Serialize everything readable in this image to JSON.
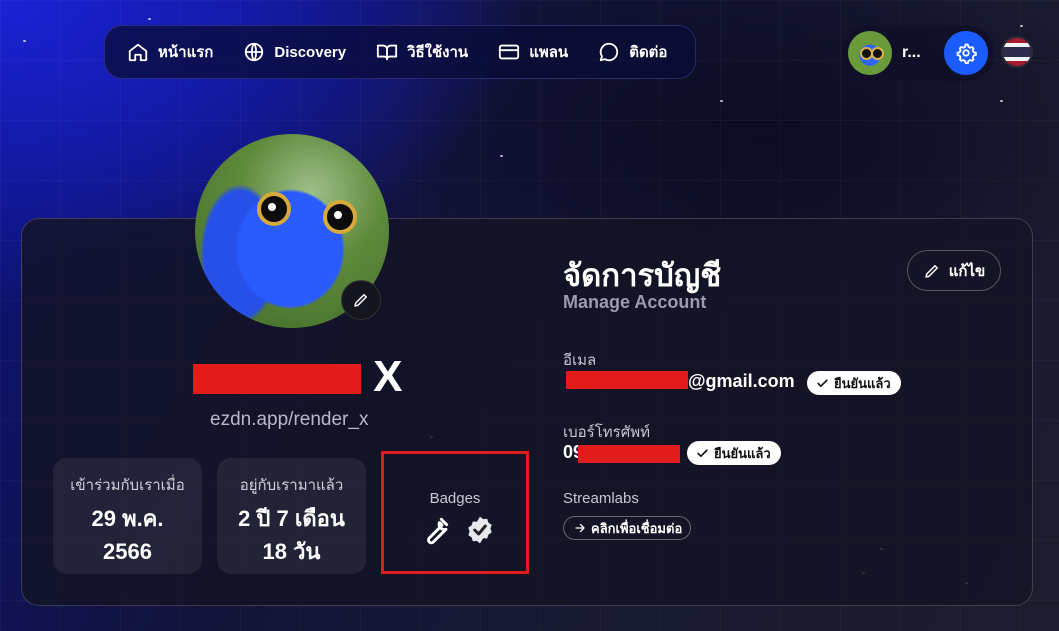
{
  "nav": {
    "items": [
      {
        "label": "หน้าแรก",
        "icon": "home-icon"
      },
      {
        "label": "Discovery",
        "icon": "globe-icon"
      },
      {
        "label": "วิธีใช้งาน",
        "icon": "book-icon"
      },
      {
        "label": "แพลน",
        "icon": "card-icon"
      },
      {
        "label": "ติดต่อ",
        "icon": "chat-icon"
      }
    ]
  },
  "user": {
    "short_name": "r...",
    "username_visible_suffix": "X",
    "profile_url": "ezdn.app/render_x"
  },
  "stats": [
    {
      "label": "เข้าร่วมกับเราเมื่อ",
      "value_line1": "29 พ.ค.",
      "value_line2": "2566"
    },
    {
      "label": "อยู่กับเรามาแล้ว",
      "value_line1": "2 ปี 7 เดือน",
      "value_line2": "18 วัน"
    }
  ],
  "badges": {
    "title": "Badges",
    "icons": [
      "wrench-icon",
      "verified-badge-icon"
    ]
  },
  "account": {
    "title": "จัดการบัญชี",
    "subtitle": "Manage Account",
    "edit_label": "แก้ไข",
    "email_label": "อีเมล",
    "email_visible": "@gmail.com",
    "phone_label": "เบอร์โทรศัพท์",
    "phone_visible": "09",
    "verified_label": "ยืนยันแล้ว",
    "streamlabs_label": "Streamlabs",
    "connect_label": "คลิกเพื่อเชื่อมต่อ"
  },
  "colors": {
    "accent": "#1a5cff",
    "redaction": "#e21b1b",
    "highlight_box": "#e21b1b"
  }
}
